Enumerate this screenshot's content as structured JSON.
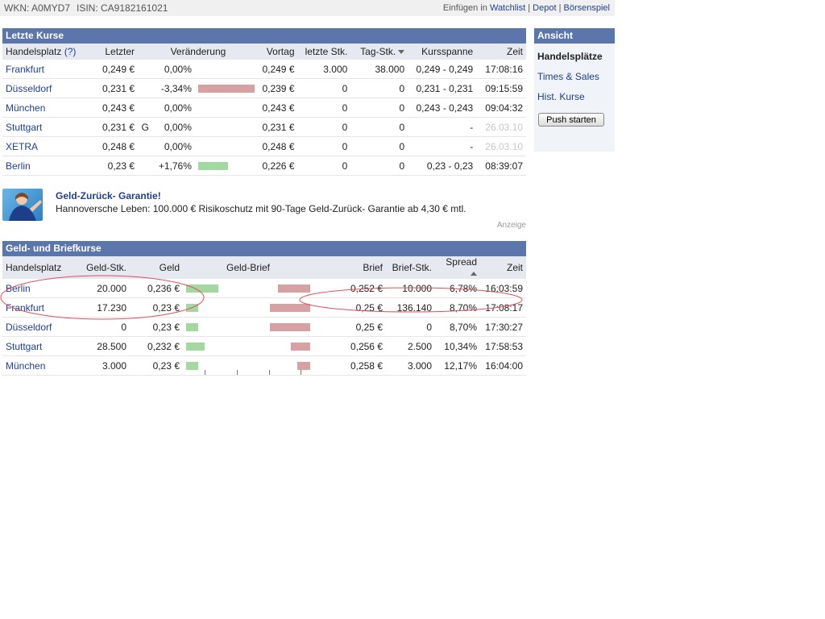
{
  "header": {
    "wkn": "WKN: A0MYD7",
    "isin": "ISIN: CA9182161021",
    "insert_label": "Einfügen in",
    "watchlist": "Watchlist",
    "sep1": "|",
    "depot": "Depot",
    "sep2": "|",
    "boersenspiel": "Börsenspiel"
  },
  "kurse": {
    "title": "Letzte Kurse",
    "headers": {
      "handelsplatz": "Handelsplatz",
      "help": "(?)",
      "letzter": "Letzter",
      "veraenderung": "Veränderung",
      "vortag": "Vortag",
      "letzte_stk": "letzte Stk.",
      "tag_stk": "Tag-Stk.",
      "kursspanne": "Kursspanne",
      "zeit": "Zeit"
    },
    "rows": [
      {
        "place": "Frankfurt",
        "last": "0,249 €",
        "flag": "",
        "change": "0,00%",
        "bar": 0,
        "bar_color": "",
        "prev": "0,249 €",
        "last_qty": "3.000",
        "day_qty": "38.000",
        "range": "0,249 - 0,249",
        "time": "17:08:16",
        "time_grey": false
      },
      {
        "place": "Düsseldorf",
        "last": "0,231 €",
        "flag": "",
        "change": "-3,34%",
        "bar": 70,
        "bar_color": "red",
        "prev": "0,239 €",
        "last_qty": "0",
        "day_qty": "0",
        "range": "0,231 - 0,231",
        "time": "09:15:59",
        "time_grey": false
      },
      {
        "place": "München",
        "last": "0,243 €",
        "flag": "",
        "change": "0,00%",
        "bar": 0,
        "bar_color": "",
        "prev": "0,243 €",
        "last_qty": "0",
        "day_qty": "0",
        "range": "0,243 - 0,243",
        "time": "09:04:32",
        "time_grey": false
      },
      {
        "place": "Stuttgart",
        "last": "0,231 €",
        "flag": "G",
        "change": "0,00%",
        "bar": 0,
        "bar_color": "",
        "prev": "0,231 €",
        "last_qty": "0",
        "day_qty": "0",
        "range": "-",
        "time": "26.03.10",
        "time_grey": true
      },
      {
        "place": "XETRA",
        "last": "0,248 €",
        "flag": "",
        "change": "0,00%",
        "bar": 0,
        "bar_color": "",
        "prev": "0,248 €",
        "last_qty": "0",
        "day_qty": "0",
        "range": "-",
        "time": "26.03.10",
        "time_grey": true
      },
      {
        "place": "Berlin",
        "last": "0,23 €",
        "flag": "",
        "change": "+1,76%",
        "bar": 37,
        "bar_color": "green",
        "prev": "0,226 €",
        "last_qty": "0",
        "day_qty": "0",
        "range": "0,23 - 0,23",
        "time": "08:39:07",
        "time_grey": false
      }
    ]
  },
  "ad": {
    "title": "Geld-Zurück- Garantie!",
    "text": "Hannoversche Leben: 100.000 € Risikoschutz mit 90-Tage Geld-Zurück- Garantie ab 4,30 € mtl.",
    "label": "Anzeige"
  },
  "geldbrief": {
    "title": "Geld- und Briefkurse",
    "headers": {
      "handelsplatz": "Handelsplatz",
      "geld_stk": "Geld-Stk.",
      "geld": "Geld",
      "geld_brief": "Geld-Brief",
      "brief": "Brief",
      "brief_stk": "Brief-Stk.",
      "spread": "Spread",
      "zeit": "Zeit"
    },
    "rows": [
      {
        "place": "Berlin",
        "geld_qty": "20.000",
        "geld": "0,236 €",
        "g_bar": 40,
        "r_bar": 40,
        "brief": "0,252 €",
        "brief_qty": "10.000",
        "spread": "6,78%",
        "time": "16:03:59"
      },
      {
        "place": "Frankfurt",
        "geld_qty": "17.230",
        "geld": "0,23 €",
        "g_bar": 15,
        "r_bar": 50,
        "brief": "0,25 €",
        "brief_qty": "136.140",
        "spread": "8,70%",
        "time": "17:08:17"
      },
      {
        "place": "Düsseldorf",
        "geld_qty": "0",
        "geld": "0,23 €",
        "g_bar": 15,
        "r_bar": 50,
        "brief": "0,25 €",
        "brief_qty": "0",
        "spread": "8,70%",
        "time": "17:30:27"
      },
      {
        "place": "Stuttgart",
        "geld_qty": "28.500",
        "geld": "0,232 €",
        "g_bar": 23,
        "r_bar": 24,
        "brief": "0,256 €",
        "brief_qty": "2.500",
        "spread": "10,34%",
        "time": "17:58:53"
      },
      {
        "place": "München",
        "geld_qty": "3.000",
        "geld": "0,23 €",
        "g_bar": 15,
        "r_bar": 16,
        "brief": "0,258 €",
        "brief_qty": "3.000",
        "spread": "12,17%",
        "time": "16:04:00"
      }
    ]
  },
  "sidebar": {
    "title": "Ansicht",
    "items": [
      {
        "label": "Handelsplätze",
        "active": true
      },
      {
        "label": "Times & Sales",
        "active": false
      },
      {
        "label": "Hist. Kurse",
        "active": false
      }
    ],
    "push_button": "Push starten"
  },
  "colors": {
    "header_blue": "#5a76ab",
    "link": "#1f3f8f",
    "bar_green": "#a3d9a0",
    "bar_red": "#d7a1a4",
    "annotation_ellipse": "#e05060"
  }
}
